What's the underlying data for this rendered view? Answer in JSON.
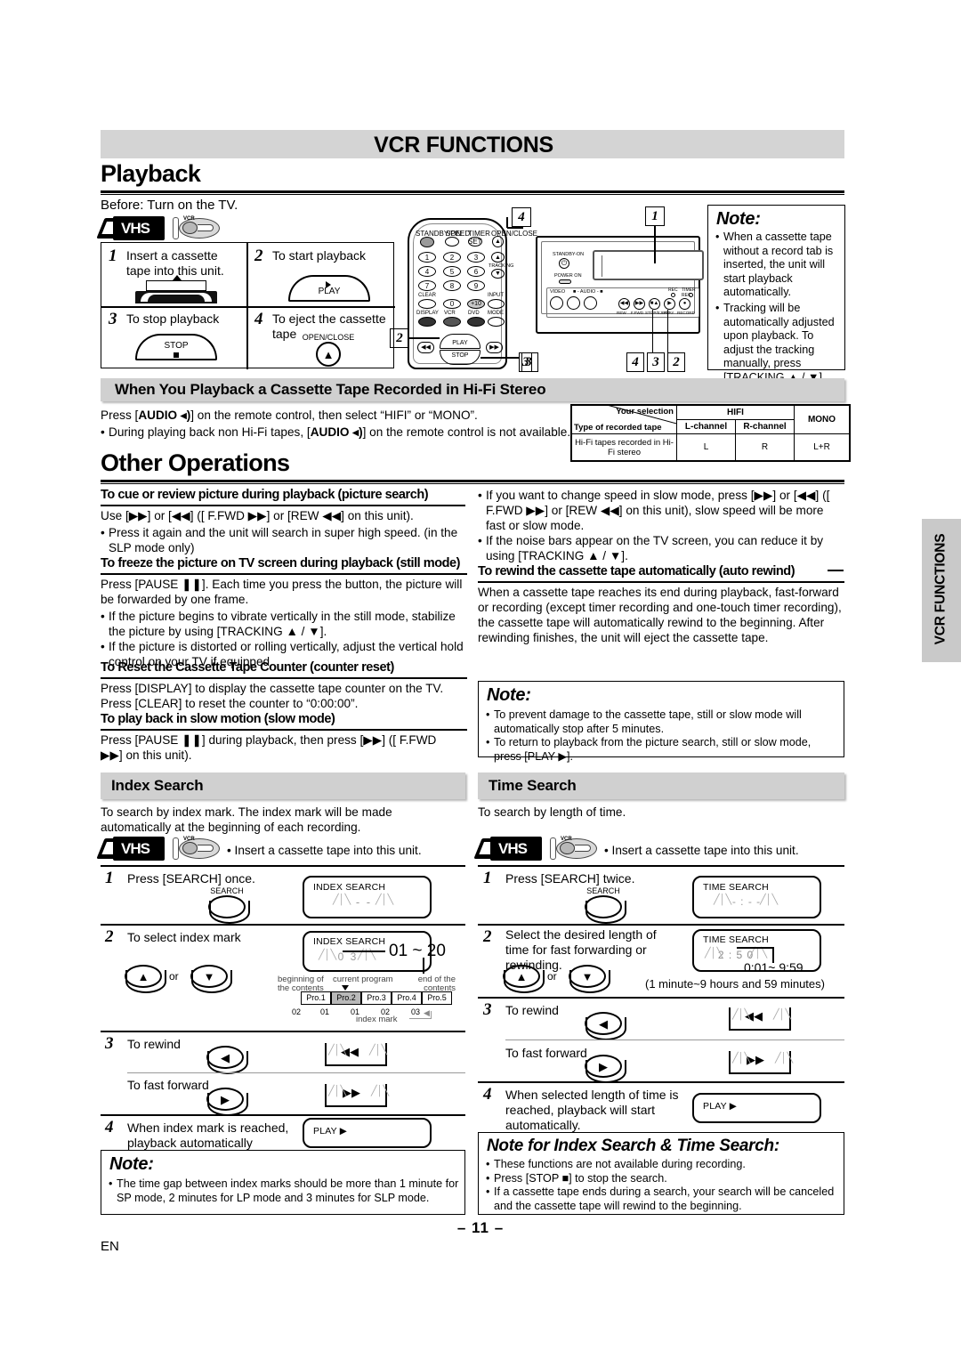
{
  "header": {
    "banner_title": "VCR FUNCTIONS",
    "section_title": "Playback",
    "section_title_2": "Other Operations",
    "before_line": "Before: Turn on the TV."
  },
  "side_tab": {
    "label": "VCR FUNCTIONS"
  },
  "footer": {
    "page_number": "– 11 –",
    "lang": "EN"
  },
  "playback_steps": {
    "s1_num": "1",
    "s1_text": "Insert a cassette tape into this unit.",
    "s2_num": "2",
    "s2_text": "To start playback",
    "s2_button": "PLAY",
    "s3_num": "3",
    "s3_text": "To stop playback",
    "s3_button": "STOP",
    "s4_num": "4",
    "s4_text": "To eject the cassette tape",
    "s4_button": "OPEN/CLOSE"
  },
  "callouts": {
    "remote_eject": "4",
    "remote_play": "2",
    "remote_stop": "3",
    "unit_tape_slot": "1",
    "unit_stopeject": "4",
    "unit_stop": "3",
    "unit_play": "2"
  },
  "remote": {
    "top_labels": [
      "STANDBY/ON",
      "SPEED",
      "TIMER SET",
      "OPEN/CLOSE"
    ],
    "keys": [
      "1",
      "2",
      "3",
      "4",
      "5",
      "6",
      "7",
      "8",
      "9",
      "0",
      "+10"
    ],
    "tracking_label": "TRACKING",
    "side_labels": [
      "CLEAR",
      "INPUT",
      "DISPLAY",
      "VCR",
      "DVD",
      "MODE"
    ],
    "transport": [
      "PLAY",
      "STOP"
    ]
  },
  "unit_panel": {
    "standby": "STANDBY-ON",
    "power": "POWER ON",
    "video": "VIDEO",
    "audio": "- AUDIO -",
    "buttons": [
      "REW",
      "F.FWD",
      "STOP/EJECT",
      "PLAY",
      "RECORD"
    ],
    "indicators": [
      "REC",
      "TIMER REC"
    ]
  },
  "note_playback": {
    "title": "Note:",
    "items": [
      "When a cassette  tape without a record tab is inserted, the unit will start playback automatically.",
      "Tracking will be automatically adjusted upon playback. To adjust the tracking manually, press [TRACKING ▲ / ▼] during playback."
    ]
  },
  "hifi_section": {
    "heading": "When You Playback a Cassette Tape Recorded in Hi-Fi Stereo",
    "line1_a": "Press [",
    "line1_b": "AUDIO ◂)",
    "line1_c": "] on the remote control, then select “HIFI” or “MONO”.",
    "line2_a": "During playing back non Hi-Fi tapes, [",
    "line2_b": "AUDIO ◂)",
    "line2_c": "] on the remote control is not available.",
    "table": {
      "corner_top": "Your selection",
      "corner_bottom": "Type of recorded tape",
      "hifi_header": "HIFI",
      "mono_header": "MONO",
      "l_channel": "L-channel",
      "r_channel": "R-channel",
      "row_label": "Hi-Fi tapes recorded in Hi-Fi stereo",
      "row_l": "L",
      "row_r": "R",
      "row_mono": "L+R"
    }
  },
  "other_ops": {
    "picture_search": {
      "heading": "To cue or review picture during playback (picture search)",
      "line1": "Use [▶▶] or [◀◀] ([ F.FWD ▶▶] or [REW ◀◀] on this unit).",
      "bullet1": "Press it again and the unit will search in super high speed. (in the SLP mode only)"
    },
    "still_mode": {
      "heading": "To freeze the picture on TV screen during playback (still mode)",
      "line1": "Press [PAUSE ❚❚]. Each time you press the button, the picture will be forwarded by one frame.",
      "bullet1": "If the picture begins to vibrate vertically in the still mode, stabilize the picture by using [TRACKING ▲ / ▼].",
      "bullet2": "If the picture is distorted or rolling vertically, adjust the vertical hold control on your TV if equipped."
    },
    "counter_reset": {
      "heading": "To Reset the Cassette Tape Counter (counter reset)",
      "line1": "Press [DISPLAY] to display the cassette tape counter on the TV.",
      "line2": "Press [CLEAR] to reset the counter to “0:00:00”."
    },
    "slow_mode": {
      "heading": "To play back in slow motion (slow mode)",
      "line1": "Press [PAUSE ❚❚] during playback, then press [▶▶] ([ F.FWD ▶▶] on this unit)."
    },
    "right_bullets": {
      "b1": "If you want to change speed in slow mode, press [▶▶] or [◀◀] ([ F.FWD ▶▶] or [REW ◀◀] on this unit), slow speed will be more fast or slow mode.",
      "b2": "If the noise bars appear on the TV screen, you can reduce it by using [TRACKING ▲ / ▼]."
    },
    "auto_rewind": {
      "heading": "To rewind the cassette tape automatically (auto rewind)",
      "body": "When a cassette tape reaches its end during playback, fast-forward or recording (except timer recording and one-touch timer recording), the cassette tape will automatically rewind to the beginning. After rewinding finishes, the unit will eject the cassette tape."
    },
    "note": {
      "title": "Note:",
      "b1": "To prevent damage to the cassette tape, still or slow mode will automatically stop after 5 minutes.",
      "b2": "To return to playback from the picture search, still or slow mode, press [PLAY ▶]."
    }
  },
  "index_search": {
    "heading": "Index Search",
    "intro": "To search by index mark. The index mark will be made automatically at the beginning of each recording.",
    "insert_note": "• Insert a cassette tape into this unit.",
    "steps": [
      {
        "num": "1",
        "text": "Press [SEARCH] once.",
        "button": "SEARCH",
        "display_title": "INDEX SEARCH",
        "display_value": "- -"
      },
      {
        "num": "2",
        "text": "To select index mark",
        "button": "▲ or ▼",
        "display_title": "INDEX SEARCH",
        "display_value": "0 3",
        "range": "01 ~ 20"
      },
      {
        "num": "3",
        "text": "To rewind",
        "text2": "To fast forward"
      },
      {
        "num": "4",
        "text": "When index mark is reached, playback automatically begins.",
        "display_title": "PLAY ▶"
      }
    ],
    "diagram": {
      "left_label": "beginning of the contents",
      "center_label": "current program",
      "right_label": "end of the contents",
      "programs": [
        "Pro.1",
        "Pro.2",
        "Pro.3",
        "Pro.4",
        "Pro.5"
      ],
      "current_index": 1,
      "marks": [
        "02",
        "01",
        "01",
        "02",
        "03"
      ],
      "index_mark_label": "index mark"
    },
    "note": {
      "title": "Note:",
      "b1": "The time gap between index marks should be more than 1 minute for SP mode, 2 minutes for LP mode and 3 minutes for SLP mode."
    }
  },
  "time_search": {
    "heading": "Time Search",
    "intro": "To search by length of time.",
    "insert_note": "• Insert a cassette tape into this unit.",
    "steps": [
      {
        "num": "1",
        "text": "Press [SEARCH] twice.",
        "button": "SEARCH",
        "display_title": "TIME SEARCH",
        "display_value": "- : - -"
      },
      {
        "num": "2",
        "text": "Select the desired length of time for fast forwarding or rewinding.",
        "button": "▲ or ▼",
        "display_title": "TIME SEARCH",
        "display_value": "2 : 5 0",
        "range": "0:01~ 9:59",
        "range_note": "(1 minute~9 hours and 59 minutes)"
      },
      {
        "num": "3",
        "text": "To rewind",
        "text2": "To fast forward"
      },
      {
        "num": "4",
        "text": "When selected length of time is reached, playback will start automatically.",
        "display_title": "PLAY ▶"
      }
    ]
  },
  "note_search": {
    "title": "Note for Index Search & Time Search:",
    "b1": "These functions are not available during recording.",
    "b2": "Press [STOP ■] to stop the search.",
    "b3": "If a cassette tape ends during a search, your search will be canceled and the cassette tape will rewind to the beginning."
  },
  "colors": {
    "banner_bg": "#d4d4d4",
    "subbar_bg": "#d0d0d0",
    "sidetab_bg": "#c9c9c9",
    "grey_text": "#8c8c8c"
  }
}
